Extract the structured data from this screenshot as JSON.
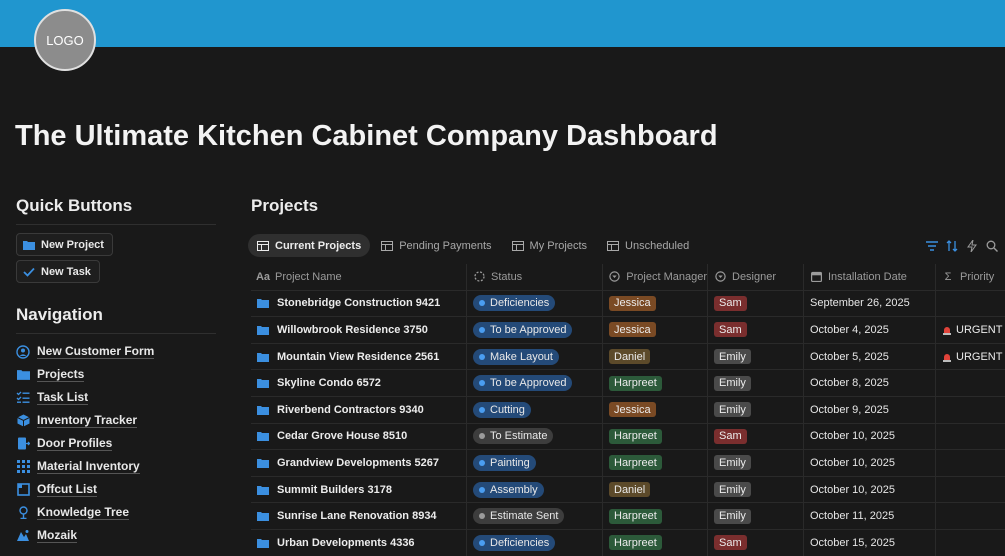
{
  "header": {
    "logo_text": "LOGO",
    "title": "The Ultimate Kitchen Cabinet Company Dashboard"
  },
  "quick_buttons": {
    "title": "Quick Buttons",
    "new_project": "New Project",
    "new_task": "New Task"
  },
  "navigation": {
    "title": "Navigation",
    "items": [
      {
        "label": "New Customer Form",
        "icon": "user-circle-icon"
      },
      {
        "label": "Projects",
        "icon": "folder-icon"
      },
      {
        "label": "Task List",
        "icon": "checklist-icon"
      },
      {
        "label": "Inventory Tracker",
        "icon": "box-icon"
      },
      {
        "label": "Door Profiles",
        "icon": "door-icon"
      },
      {
        "label": "Material Inventory",
        "icon": "grid-icon"
      },
      {
        "label": "Offcut List",
        "icon": "square-icon"
      },
      {
        "label": "Knowledge Tree",
        "icon": "tree-icon"
      },
      {
        "label": "Mozaik",
        "icon": "mozaik-icon"
      }
    ]
  },
  "projects": {
    "title": "Projects",
    "tabs": [
      "Current Projects",
      "Pending Payments",
      "My Projects",
      "Unscheduled"
    ],
    "columns": [
      "Project Name",
      "Status",
      "Project Manager",
      "Designer",
      "Installation Date",
      "Priority"
    ],
    "rows": [
      {
        "name": "Stonebridge Construction 9421",
        "status": "Deficiencies",
        "pm": "Jessica",
        "designer": "Sam",
        "date": "September 26, 2025",
        "priority": ""
      },
      {
        "name": "Willowbrook Residence 3750",
        "status": "To be Approved",
        "pm": "Jessica",
        "designer": "Sam",
        "date": "October 4, 2025",
        "priority": "URGENT"
      },
      {
        "name": "Mountain View Residence 2561",
        "status": "Make Layout",
        "pm": "Daniel",
        "designer": "Emily",
        "date": "October 5, 2025",
        "priority": "URGENT"
      },
      {
        "name": "Skyline Condo 6572",
        "status": "To be Approved",
        "pm": "Harpreet",
        "designer": "Emily",
        "date": "October 8, 2025",
        "priority": ""
      },
      {
        "name": "Riverbend Contractors 9340",
        "status": "Cutting",
        "pm": "Jessica",
        "designer": "Emily",
        "date": "October 9, 2025",
        "priority": ""
      },
      {
        "name": "Cedar Grove House 8510",
        "status": "To Estimate",
        "pm": "Harpreet",
        "designer": "Sam",
        "date": "October 10, 2025",
        "priority": ""
      },
      {
        "name": "Grandview Developments 5267",
        "status": "Painting",
        "pm": "Harpreet",
        "designer": "Emily",
        "date": "October 10, 2025",
        "priority": ""
      },
      {
        "name": "Summit Builders 3178",
        "status": "Assembly",
        "pm": "Daniel",
        "designer": "Emily",
        "date": "October 10, 2025",
        "priority": ""
      },
      {
        "name": "Sunrise Lane Renovation 8934",
        "status": "Estimate Sent",
        "pm": "Harpreet",
        "designer": "Emily",
        "date": "October 11, 2025",
        "priority": ""
      },
      {
        "name": "Urban Developments 4336",
        "status": "Deficiencies",
        "pm": "Harpreet",
        "designer": "Sam",
        "date": "October 15, 2025",
        "priority": ""
      }
    ]
  },
  "colors": {
    "banner": "#2096cf",
    "status_blue": "#244a78",
    "status_gray": "#3d3d3d",
    "jessica": "#7a4a24",
    "daniel": "#5c4a2a",
    "harpreet": "#2c5a3a",
    "sam": "#7a2e2e",
    "emily": "#4a4a4a"
  }
}
